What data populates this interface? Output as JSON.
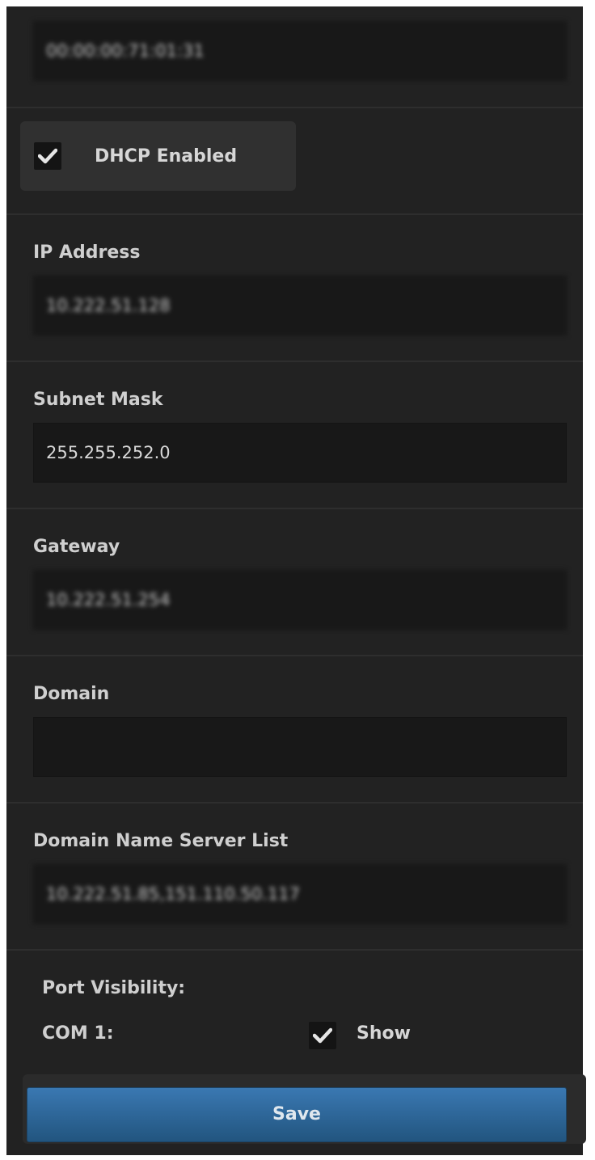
{
  "mac_field": {
    "value": "00:00:00:71:01:31"
  },
  "dhcp": {
    "label": "DHCP Enabled",
    "checked": true
  },
  "ip_address": {
    "label": "IP Address",
    "value": "10.222.51.128"
  },
  "subnet_mask": {
    "label": "Subnet Mask",
    "value": "255.255.252.0"
  },
  "gateway": {
    "label": "Gateway",
    "value": "10.222.51.254"
  },
  "domain": {
    "label": "Domain",
    "value": ""
  },
  "dns": {
    "label": "Domain Name Server List",
    "value": "10.222.51.85,151.110.50.117"
  },
  "port_visibility": {
    "title": "Port Visibility:",
    "ports": [
      {
        "name": "COM 1:",
        "show_label": "Show",
        "checked": true
      }
    ]
  },
  "save_button": {
    "label": "Save"
  },
  "colors": {
    "panel": "#222222",
    "field": "#181818",
    "accent": "#2f6a9f"
  },
  "icons": [
    "checkmark-icon"
  ]
}
